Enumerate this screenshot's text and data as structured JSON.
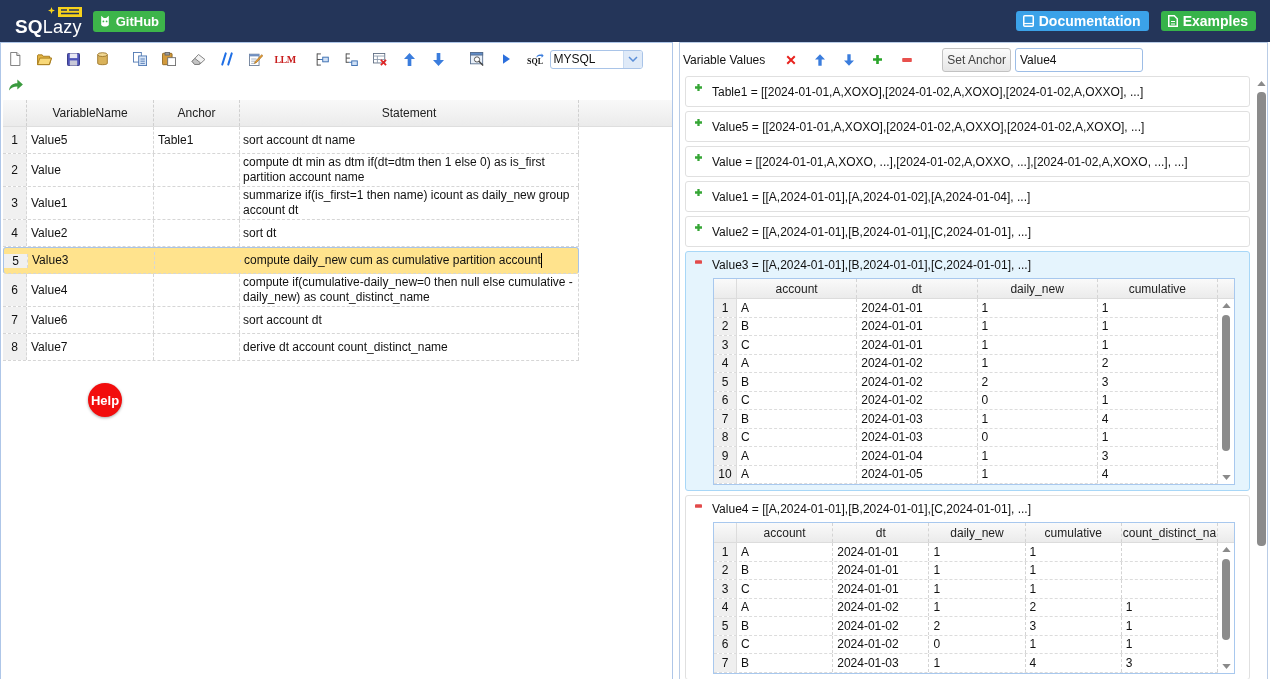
{
  "header": {
    "logo": "**SQ**Lazy",
    "github_button": "GitHub",
    "links": [
      {
        "kind": "docs",
        "label": "Documentation",
        "color": "#3ba2e9"
      },
      {
        "kind": "examples",
        "label": "Examples",
        "color": "#37b34a"
      }
    ]
  },
  "editor": {
    "toolbar": {
      "llm_label": "LLM",
      "sql_label": "SQL",
      "dialect": "MYSQL"
    },
    "columns": [
      "VariableName",
      "Anchor",
      "Statement"
    ],
    "rows": [
      {
        "number": "1",
        "variable_name": "Value5",
        "anchor": "Table1",
        "statement": "sort account dt name",
        "selected": false,
        "editing": false
      },
      {
        "number": "2",
        "variable_name": "Value",
        "statement": "compute dt min as dtm if(dt=dtm then 1 else 0) as is_first partition account name",
        "selected": false,
        "editing": false
      },
      {
        "number": "3",
        "variable_name": "Value1",
        "statement": "summarize if(is_first=1 then name) icount as daily_new group account dt",
        "selected": false,
        "editing": false
      },
      {
        "number": "4",
        "variable_name": "Value2",
        "statement": "sort dt",
        "selected": false,
        "editing": false
      },
      {
        "number": "5",
        "variable_name": "Value3",
        "statement": "compute daily_new cum as cumulative partition account",
        "selected": true,
        "editing": true
      },
      {
        "number": "6",
        "variable_name": "Value4",
        "statement": "compute if(cumulative-daily_new=0 then null else cumulative - daily_new) as count_distinct_name",
        "selected": false,
        "editing": false
      },
      {
        "number": "7",
        "variable_name": "Value6",
        "statement": "sort account dt",
        "selected": false,
        "editing": false
      },
      {
        "number": "8",
        "variable_name": "Value7",
        "statement": "derive dt account count_distinct_name",
        "selected": false,
        "editing": false
      }
    ],
    "help_button": "Help"
  },
  "variables_panel": {
    "title": "Variable Values",
    "set_anchor_button": "Set Anchor",
    "anchor_input": "Value4",
    "items": [
      {
        "summary": "Table1 = [[2024-01-01,A,XOXO],[2024-01-02,A,XOXO],[2024-01-02,A,OXXO], ...]",
        "expanded": false,
        "selected": false
      },
      {
        "summary": "Value5 = [[2024-01-01,A,XOXO],[2024-01-02,A,OXXO],[2024-01-02,A,XOXO], ...]",
        "expanded": false,
        "selected": false
      },
      {
        "summary": "Value = [[2024-01-01,A,XOXO, ...],[2024-01-02,A,OXXO, ...],[2024-01-02,A,XOXO, ...], ...]",
        "expanded": false,
        "selected": false
      },
      {
        "summary": "Value1 = [[A,2024-01-01],[A,2024-01-02],[A,2024-01-04], ...]",
        "expanded": false,
        "selected": false
      },
      {
        "summary": "Value2 = [[A,2024-01-01],[B,2024-01-01],[C,2024-01-01], ...]",
        "expanded": false,
        "selected": false
      },
      {
        "summary": "Value3 = [[A,2024-01-01],[B,2024-01-01],[C,2024-01-01], ...]",
        "expanded": true,
        "selected": true,
        "table": {
          "columns": [
            "account",
            "dt",
            "daily_new",
            "cumulative"
          ],
          "rows": [
            {
              "number": "1",
              "cells": [
                "A",
                "2024-01-01",
                "1",
                "1"
              ]
            },
            {
              "number": "2",
              "cells": [
                "B",
                "2024-01-01",
                "1",
                "1"
              ]
            },
            {
              "number": "3",
              "cells": [
                "C",
                "2024-01-01",
                "1",
                "1"
              ]
            },
            {
              "number": "4",
              "cells": [
                "A",
                "2024-01-02",
                "1",
                "2"
              ]
            },
            {
              "number": "5",
              "cells": [
                "B",
                "2024-01-02",
                "2",
                "3"
              ]
            },
            {
              "number": "6",
              "cells": [
                "C",
                "2024-01-02",
                "0",
                "1"
              ]
            },
            {
              "number": "7",
              "cells": [
                "B",
                "2024-01-03",
                "1",
                "4"
              ]
            },
            {
              "number": "8",
              "cells": [
                "C",
                "2024-01-03",
                "0",
                "1"
              ]
            },
            {
              "number": "9",
              "cells": [
                "A",
                "2024-01-04",
                "1",
                "3"
              ]
            },
            {
              "number": "10",
              "cells": [
                "A",
                "2024-01-05",
                "1",
                "4"
              ]
            }
          ]
        }
      },
      {
        "summary": "Value4 = [[A,2024-01-01],[B,2024-01-01],[C,2024-01-01], ...]",
        "expanded": true,
        "selected": false,
        "table": {
          "columns": [
            "account",
            "dt",
            "daily_new",
            "cumulative",
            "count_distinct_na"
          ],
          "rows": [
            {
              "number": "1",
              "cells": [
                "A",
                "2024-01-01",
                "1",
                "1"
              ]
            },
            {
              "number": "2",
              "cells": [
                "B",
                "2024-01-01",
                "1",
                "1"
              ]
            },
            {
              "number": "3",
              "cells": [
                "C",
                "2024-01-01",
                "1",
                "1"
              ]
            },
            {
              "number": "4",
              "cells": [
                "A",
                "2024-01-02",
                "1",
                "2",
                "1"
              ]
            },
            {
              "number": "5",
              "cells": [
                "B",
                "2024-01-02",
                "2",
                "3",
                "1"
              ]
            },
            {
              "number": "6",
              "cells": [
                "C",
                "2024-01-02",
                "0",
                "1",
                "1"
              ]
            },
            {
              "number": "7",
              "cells": [
                "B",
                "2024-01-03",
                "1",
                "4",
                "3"
              ]
            }
          ]
        }
      }
    ]
  }
}
